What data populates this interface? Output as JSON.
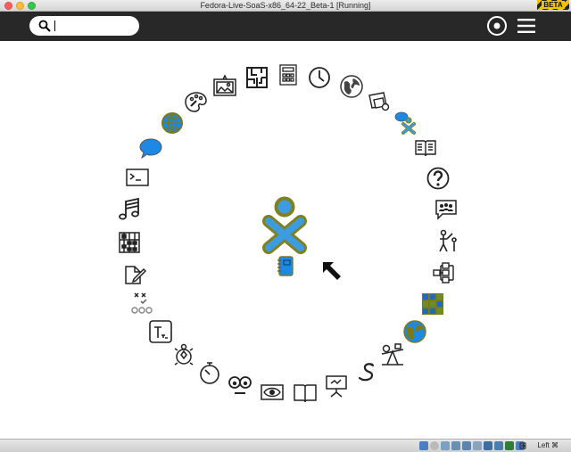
{
  "window": {
    "title": "Fedora-Live-SoaS-x86_64-22_Beta-1 [Running]",
    "badge": "BETA"
  },
  "toolbar": {
    "search_value": ""
  },
  "statusbar": {
    "host_key": "Left ⌘"
  },
  "colors": {
    "toolbar_bg": "#282828",
    "xo_stroke": "#808020",
    "xo_fill": "#3d9be0",
    "accent_blue": "#1e88e5",
    "olive": "#7a7a1c"
  },
  "ring_icons": [
    "puzzle-maze-icon",
    "calculator-icon",
    "clock-icon",
    "globe-icon",
    "photo-icon",
    "chat-xo-icon",
    "read-book-icon",
    "help-icon",
    "people-chat-icon",
    "teacher-student-icon",
    "network-icon",
    "grid-game-icon",
    "world-map-icon",
    "seesaw-icon",
    "snake-icon",
    "presentation-icon",
    "book-icon",
    "eye-icon",
    "face-icon",
    "stopwatch-icon",
    "turtle-icon",
    "typing-icon",
    "tictactoe-icon",
    "write-icon",
    "abacus-icon",
    "music-icon",
    "terminal-icon",
    "speech-bubble-icon",
    "browse-globe-icon",
    "paint-icon",
    "image-viewer-icon"
  ]
}
